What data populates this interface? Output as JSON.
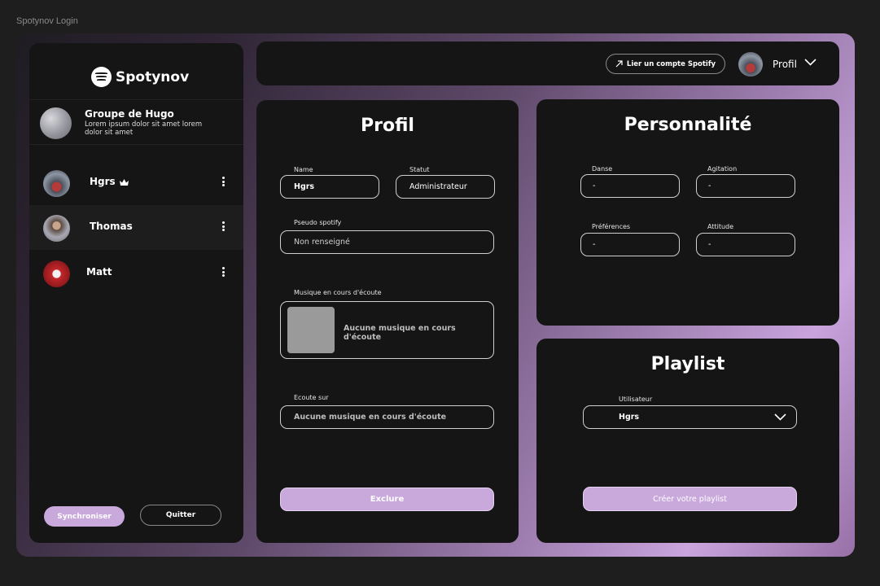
{
  "window": {
    "title": "Spotynov Login"
  },
  "colors": {
    "accent": "#c9a8dc",
    "panel": "#151515"
  },
  "sidebar": {
    "logo_text": "Spotynov",
    "group": {
      "name": "Groupe de Hugo",
      "description": "Lorem ipsum dolor sit amet lorem dolor sit amet"
    },
    "members": [
      {
        "name": "Hgrs",
        "leader": true,
        "menu_icon": "more-vertical-icon"
      },
      {
        "name": "Thomas",
        "leader": false,
        "menu_icon": "more-vertical-icon"
      },
      {
        "name": "Matt",
        "leader": false,
        "menu_icon": "more-vertical-icon"
      }
    ],
    "sync_label": "Synchroniser",
    "quit_label": "Quitter"
  },
  "header": {
    "link_label": "Lier un compte Spotify",
    "profile_label": "Profil"
  },
  "profile": {
    "title": "Profil",
    "name_label": "Name",
    "name_value": "Hgrs",
    "status_label": "Statut",
    "status_value": "Administrateur",
    "pseudo_label": "Pseudo spotify",
    "pseudo_value": "Non renseigné",
    "now_playing_label": "Musique en cours d'écoute",
    "now_playing_value": "Aucune musique en cours d'écoute",
    "listening_on_label": "Ecoute sur",
    "listening_on_value": "Aucune musique en cours d'écoute",
    "exclude_label": "Exclure"
  },
  "personality": {
    "title": "Personnalité",
    "fields": [
      {
        "label": "Danse",
        "value": "-"
      },
      {
        "label": "Agitation",
        "value": "-"
      },
      {
        "label": "Préférences",
        "value": "-"
      },
      {
        "label": "Attitude",
        "value": "-"
      }
    ]
  },
  "playlist": {
    "title": "Playlist",
    "user_label": "Utilisateur",
    "user_value": "Hgrs",
    "create_label": "Créer votre playlist"
  }
}
